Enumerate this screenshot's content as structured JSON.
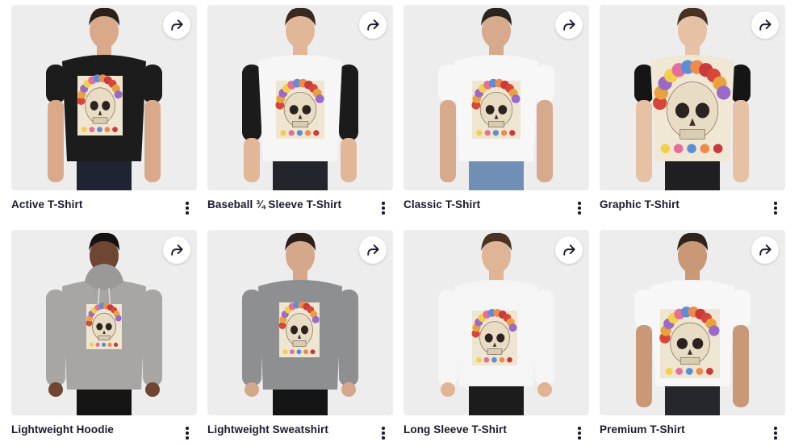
{
  "products": [
    {
      "title": "Active T-Shirt",
      "variant": "active",
      "shirt": "#1c1c1c",
      "sleeve": "#1c1c1c",
      "skin": "#d9a98a",
      "hair": "#2a211c",
      "pants": "#1f2433"
    },
    {
      "title": "Baseball ¾ Sleeve T-Shirt",
      "variant": "baseball",
      "shirt": "#f6f6f6",
      "sleeve": "#1b1b1b",
      "skin": "#e2b797",
      "hair": "#3a2a1e",
      "pants": "#22252c"
    },
    {
      "title": "Classic T-Shirt",
      "variant": "classic",
      "shirt": "#f7f7f7",
      "sleeve": "#f7f7f7",
      "skin": "#d7aa8e",
      "hair": "#2b241e",
      "pants": "#6f8fb4"
    },
    {
      "title": "Graphic T-Shirt",
      "variant": "graphic",
      "shirt": "#f0e7d5",
      "sleeve": "#151515",
      "skin": "#e7c1a3",
      "hair": "#4a3222",
      "pants": "#1f1f22"
    },
    {
      "title": "Lightweight Hoodie",
      "variant": "hoodie",
      "shirt": "#a7a6a4",
      "sleeve": "#a7a6a4",
      "skin": "#6e4631",
      "hair": "#161212",
      "pants": "#141414"
    },
    {
      "title": "Lightweight Sweatshirt",
      "variant": "sweatshirt",
      "shirt": "#8e8f90",
      "sleeve": "#8e8f90",
      "skin": "#d5a88b",
      "hair": "#2a1f19",
      "pants": "#141414"
    },
    {
      "title": "Long Sleeve T-Shirt",
      "variant": "longsleeve",
      "shirt": "#f5f5f5",
      "sleeve": "#f5f5f5",
      "skin": "#e0b596",
      "hair": "#4a3324",
      "pants": "#1c1c1c"
    },
    {
      "title": "Premium T-Shirt",
      "variant": "premium",
      "shirt": "#f7f7f7",
      "sleeve": "#f7f7f7",
      "skin": "#c99876",
      "hair": "#2f241c",
      "pants": "#25272d"
    }
  ],
  "icons": {
    "share": "share-arrow-icon",
    "more": "vertical-ellipsis-icon"
  },
  "colors": {
    "thumb_bg": "#ededed",
    "title_text": "#1a1a2e",
    "icon": "#1a1a2e"
  }
}
